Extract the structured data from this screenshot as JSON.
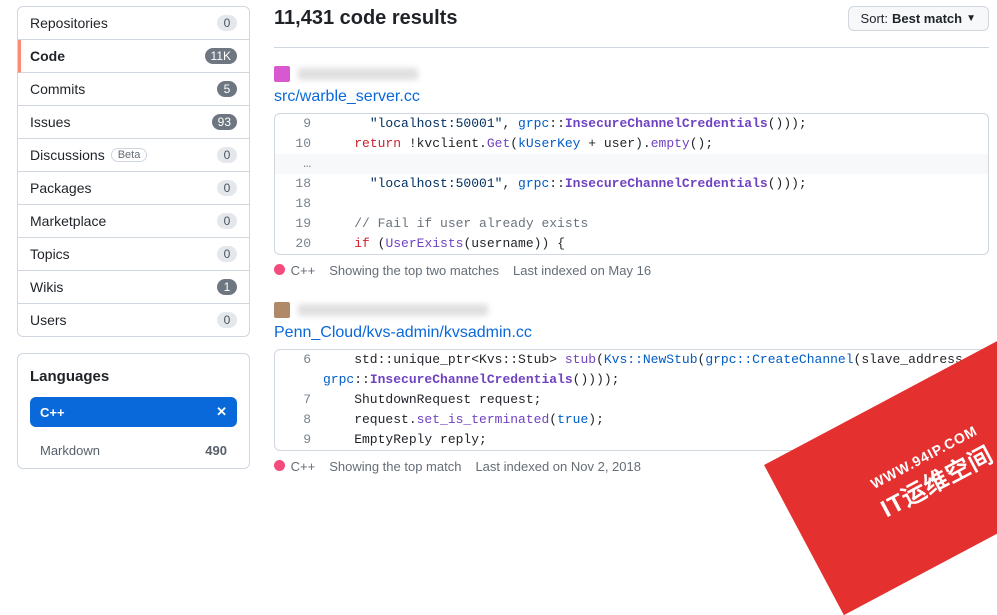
{
  "sidebar": {
    "items": [
      {
        "label": "Repositories",
        "count": "0",
        "style": ""
      },
      {
        "label": "Code",
        "count": "11K",
        "style": "dark"
      },
      {
        "label": "Commits",
        "count": "5",
        "style": "dark"
      },
      {
        "label": "Issues",
        "count": "93",
        "style": "dark"
      },
      {
        "label": "Discussions",
        "count": "0",
        "beta": "Beta",
        "style": ""
      },
      {
        "label": "Packages",
        "count": "0",
        "style": ""
      },
      {
        "label": "Marketplace",
        "count": "0",
        "style": ""
      },
      {
        "label": "Topics",
        "count": "0",
        "style": ""
      },
      {
        "label": "Wikis",
        "count": "1",
        "style": "dark"
      },
      {
        "label": "Users",
        "count": "0",
        "style": ""
      }
    ]
  },
  "languages": {
    "title": "Languages",
    "selected": "C++",
    "rows": [
      {
        "name": "Markdown",
        "count": "490"
      }
    ]
  },
  "header": {
    "count_text": "11,431 code results",
    "sort_label": "Sort:",
    "sort_value": "Best match"
  },
  "results": [
    {
      "file": "src/warble_server.cc",
      "language": "C++",
      "matches_text": "Showing the top two matches",
      "indexed_text": "Last indexed on May 16",
      "lines": [
        {
          "n": "9",
          "html": "      <span class='str'>\"localhost:50001\"</span>, <span class='ns'>grpc</span>::<span class='hl'>InsecureChannelCredentials</span>()));"
        },
        {
          "n": "10",
          "html": "    <span class='kw'>return</span> !kvclient.<span class='fn'>Get</span>(<span class='ns'>kUserKey</span> + user).<span class='fn'>empty</span>();"
        },
        {
          "gap": true
        },
        {
          "n": "18",
          "html": "      <span class='str'>\"localhost:50001\"</span>, <span class='ns'>grpc</span>::<span class='hl'>InsecureChannelCredentials</span>()));"
        },
        {
          "n": "18",
          "html": ""
        },
        {
          "n": "19",
          "html": "    <span class='cmt'>// Fail if user already exists</span>"
        },
        {
          "n": "20",
          "html": "    <span class='kw'>if</span> (<span class='fn'>UserExists</span>(username)) {"
        }
      ]
    },
    {
      "file": "Penn_Cloud/kvs-admin/kvsadmin.cc",
      "language": "C++",
      "matches_text": "Showing the top match",
      "indexed_text": "Last indexed on Nov 2, 2018",
      "lines": [
        {
          "n": "6",
          "html": "    std::unique_ptr&lt;Kvs::Stub&gt; <span class='fn'>stub</span>(<span class='ns'>Kvs::NewStub</span>(<span class='ns'>grpc::CreateChannel</span>(slave_address,"
        },
        {
          "n": "",
          "html": "<span class='ns'>grpc</span>::<span class='hl'>InsecureChannelCredentials</span>())));"
        },
        {
          "n": "7",
          "html": "    ShutdownRequest request;"
        },
        {
          "n": "8",
          "html": "    request.<span class='fn'>set_is_terminated</span>(<span class='bool'>true</span>);"
        },
        {
          "n": "9",
          "html": "    EmptyReply reply;"
        }
      ]
    }
  ],
  "watermark": {
    "url": "WWW.94IP.COM",
    "text": "IT运维空间"
  }
}
